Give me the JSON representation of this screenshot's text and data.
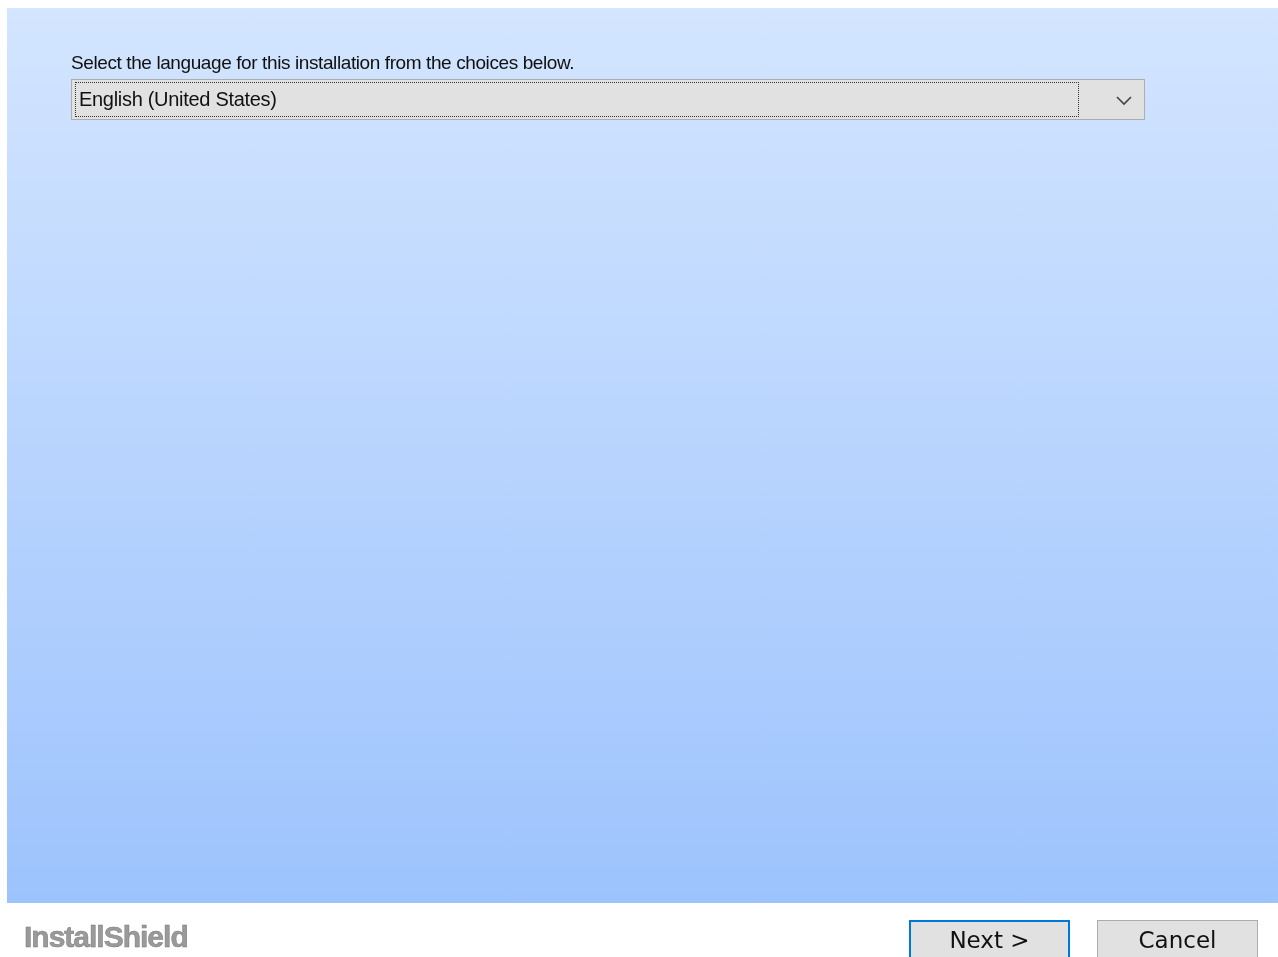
{
  "prompt": "Select the language for this installation from the choices below.",
  "language_select": {
    "value": "English (United States)",
    "focused": true
  },
  "brand": "InstallShield",
  "buttons": [
    {
      "label": "Next >",
      "default": true
    },
    {
      "label": "Cancel",
      "default": false
    }
  ]
}
